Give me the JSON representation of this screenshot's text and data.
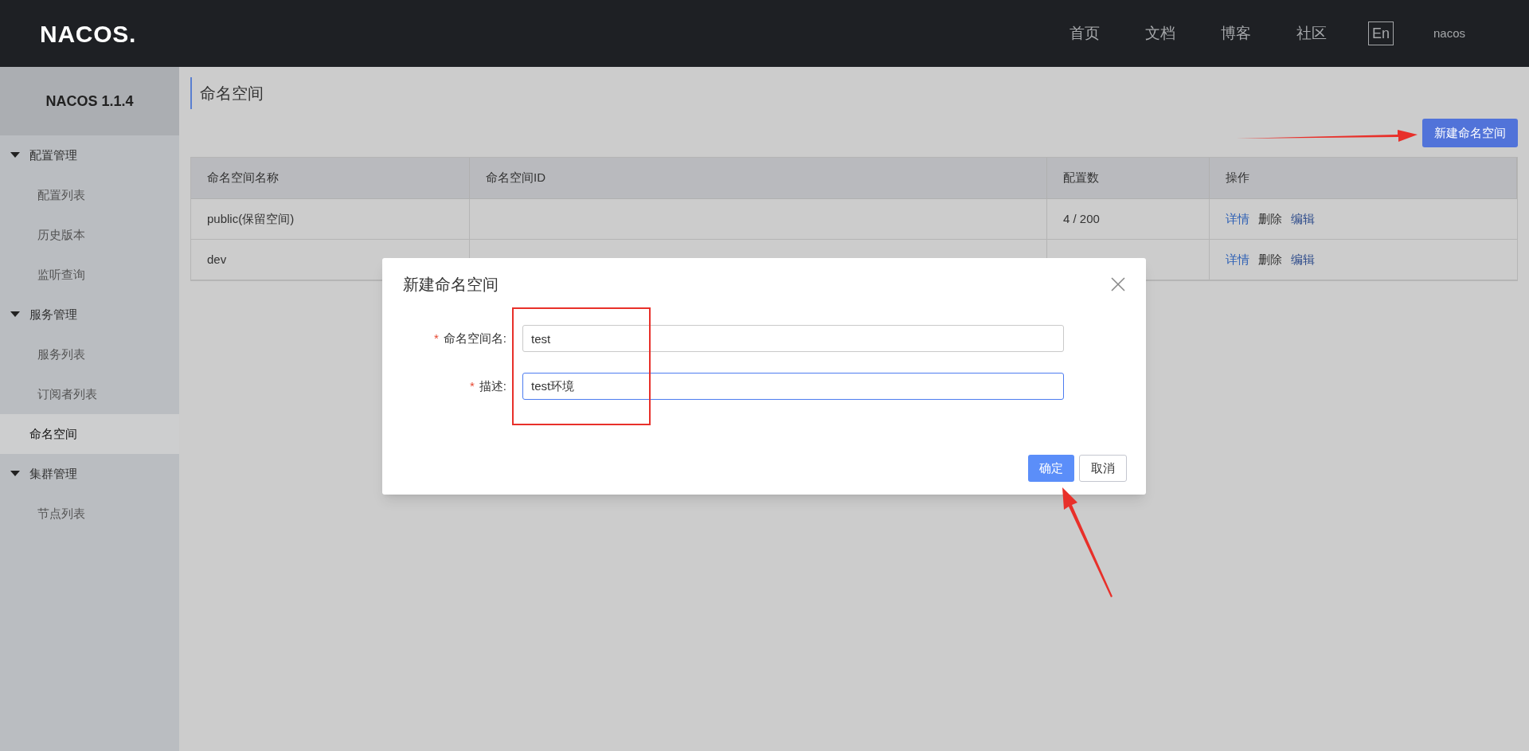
{
  "header": {
    "logo": "NACOS.",
    "nav": [
      "首页",
      "文档",
      "博客",
      "社区"
    ],
    "language": "En",
    "user": "nacos"
  },
  "sidebar": {
    "title": "NACOS 1.1.4",
    "items": [
      {
        "kind": "group",
        "label": "配置管理",
        "expanded": true,
        "children": [
          {
            "label": "配置列表",
            "selected": false
          },
          {
            "label": "历史版本",
            "selected": false
          },
          {
            "label": "监听查询",
            "selected": false
          }
        ]
      },
      {
        "kind": "group",
        "label": "服务管理",
        "expanded": true,
        "children": [
          {
            "label": "服务列表",
            "selected": false
          },
          {
            "label": "订阅者列表",
            "selected": false
          }
        ]
      },
      {
        "kind": "link",
        "label": "命名空间",
        "selected": true
      },
      {
        "kind": "group",
        "label": "集群管理",
        "expanded": true,
        "children": [
          {
            "label": "节点列表",
            "selected": false
          }
        ]
      }
    ]
  },
  "page": {
    "title": "命名空间",
    "new_button": "新建命名空间",
    "table": {
      "columns": [
        "命名空间名称",
        "命名空间ID",
        "配置数",
        "操作"
      ],
      "rows": [
        {
          "cells": [
            "public(保留空间)",
            "",
            "4 / 200"
          ],
          "actions": [
            "详情",
            "删除",
            "编辑"
          ]
        },
        {
          "cells": [
            "dev",
            "",
            ""
          ],
          "actions": [
            "详情",
            "删除",
            "编辑"
          ]
        }
      ]
    }
  },
  "dialog": {
    "title": "新建命名空间",
    "fields": [
      {
        "marker": "*",
        "label": "命名空间名:",
        "value": "test",
        "focused": false
      },
      {
        "marker": "*",
        "label": "描述:",
        "value": "test环境",
        "focused": true
      }
    ],
    "buttons": [
      {
        "label": "确定",
        "kind": "primary"
      },
      {
        "label": "取消",
        "kind": "normal"
      }
    ]
  }
}
